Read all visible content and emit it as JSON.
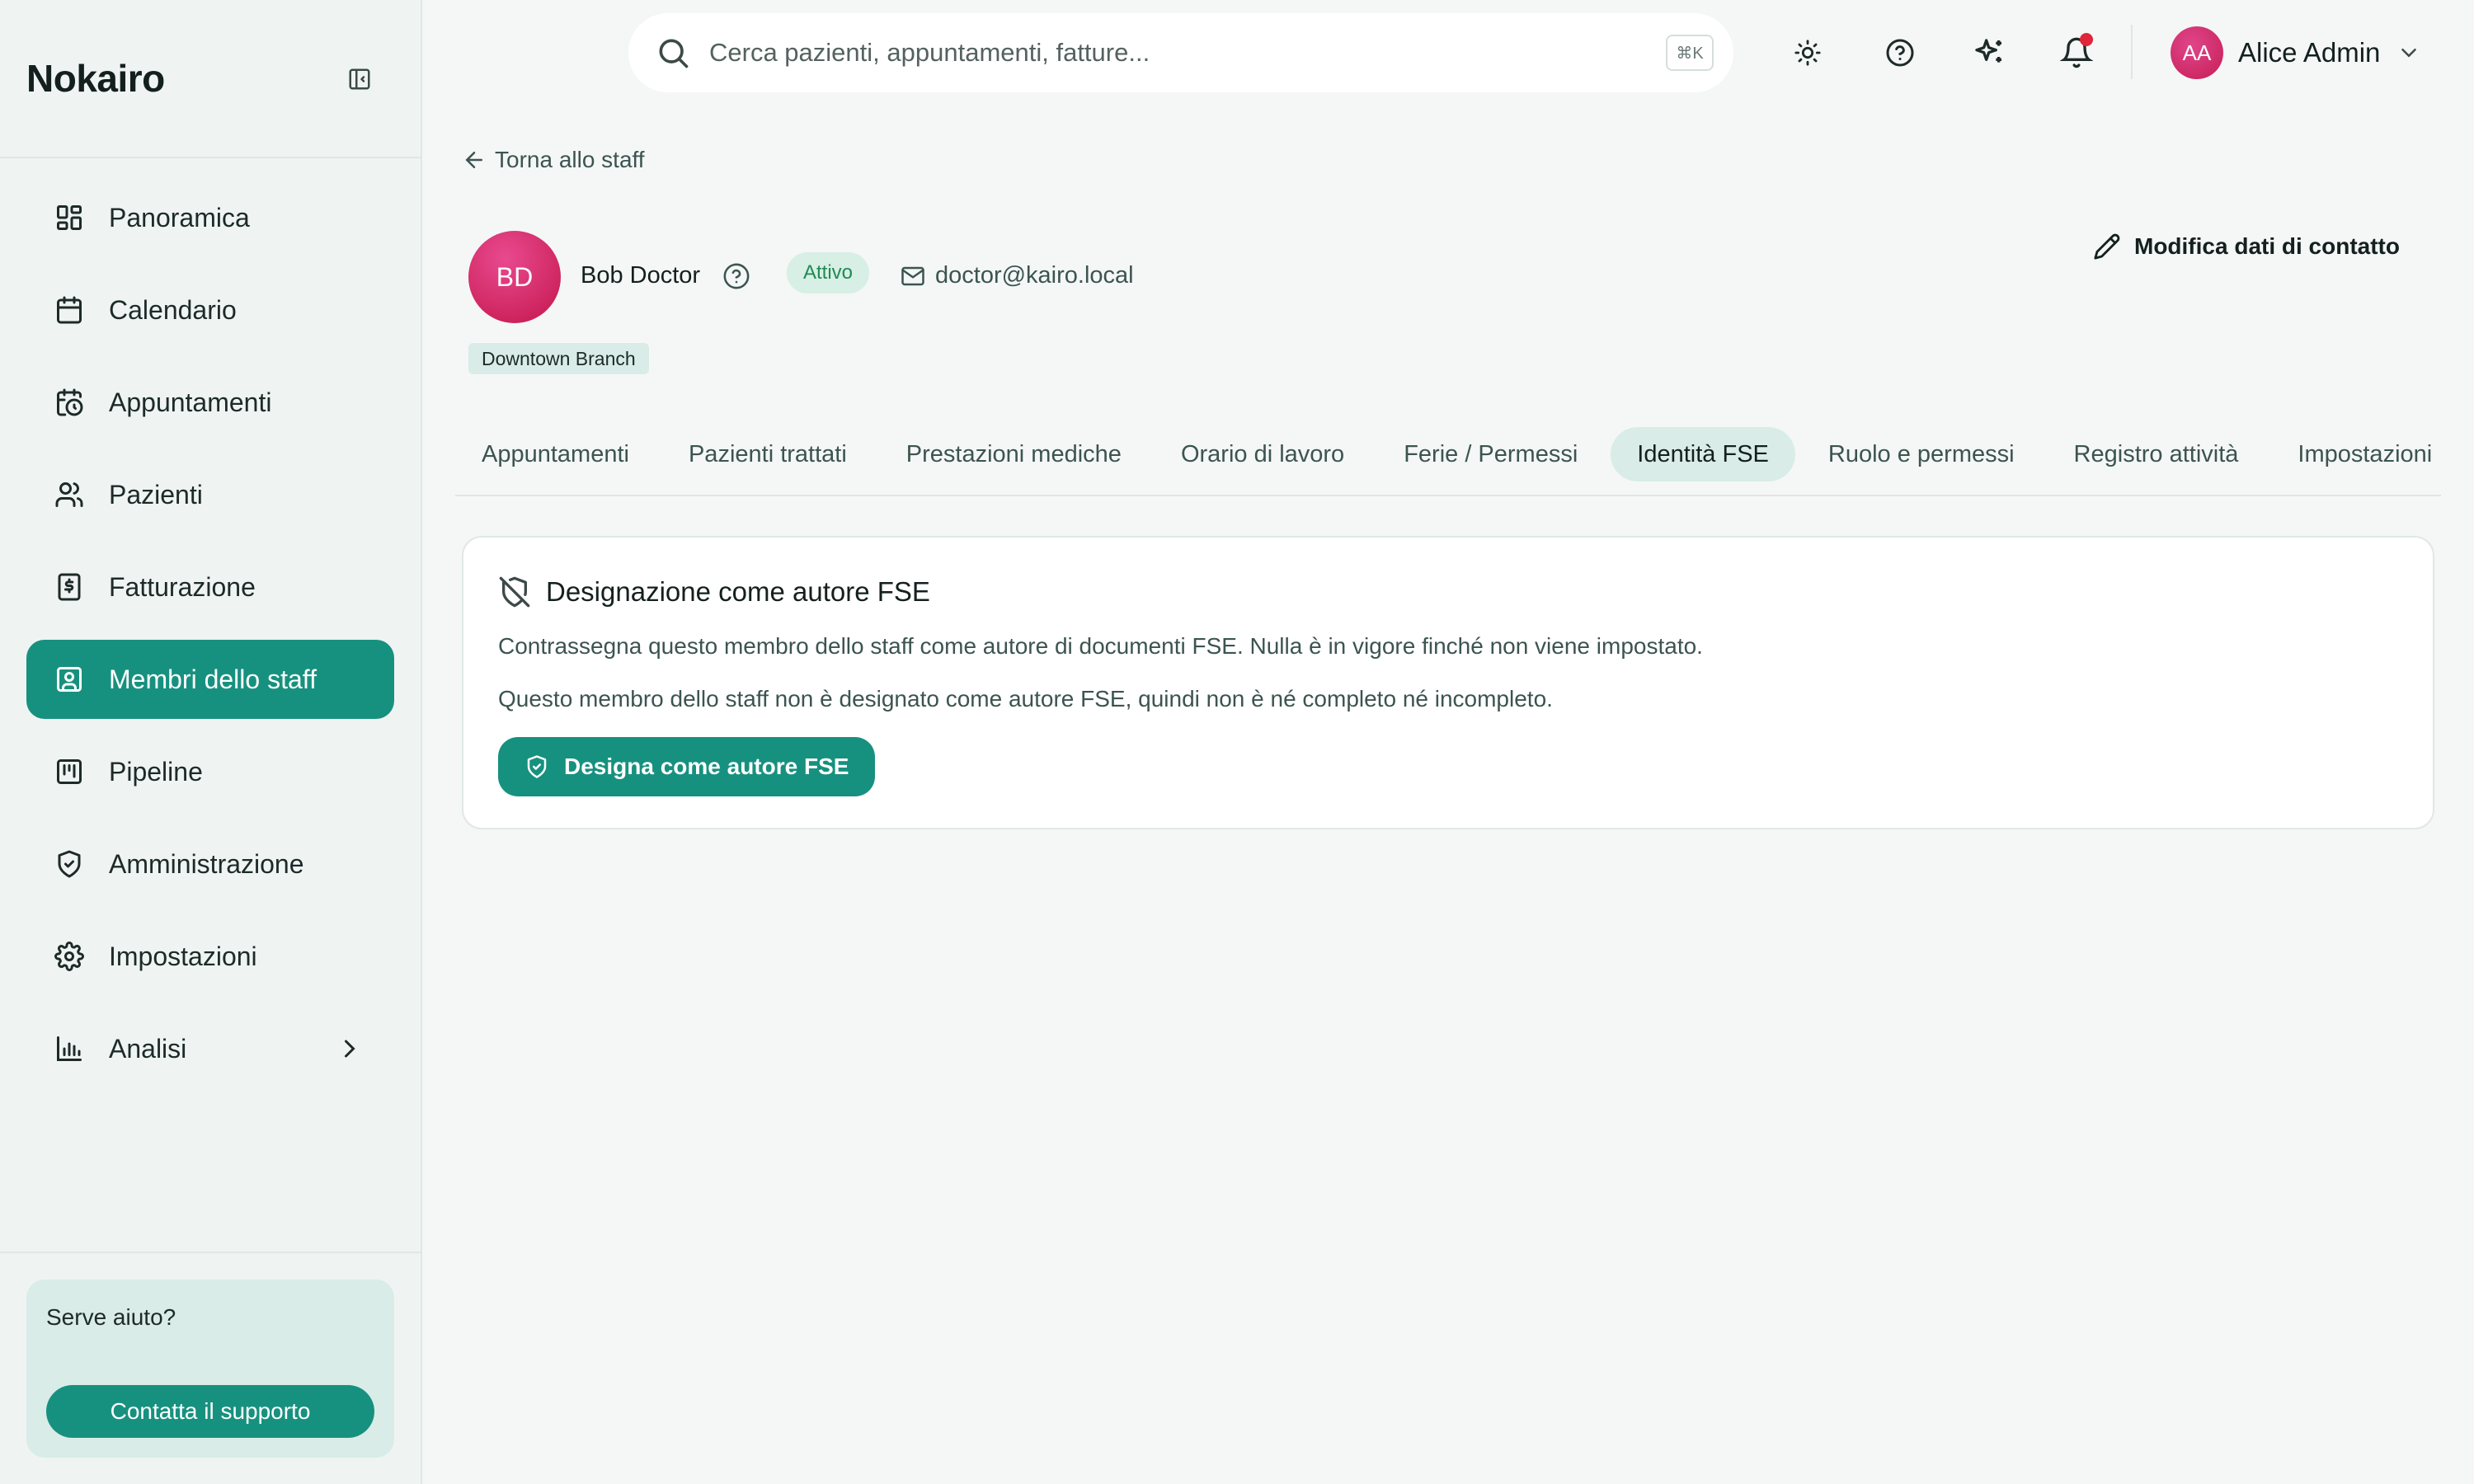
{
  "app": {
    "brand": "Nokairo"
  },
  "sidebar": {
    "items": [
      {
        "label": "Panoramica",
        "icon": "dashboard-icon"
      },
      {
        "label": "Calendario",
        "icon": "calendar-icon"
      },
      {
        "label": "Appuntamenti",
        "icon": "calendar-clock-icon"
      },
      {
        "label": "Pazienti",
        "icon": "users-icon"
      },
      {
        "label": "Fatturazione",
        "icon": "invoice-icon"
      },
      {
        "label": "Membri dello staff",
        "icon": "staff-badge-icon",
        "active": true
      },
      {
        "label": "Pipeline",
        "icon": "kanban-icon"
      },
      {
        "label": "Amministrazione",
        "icon": "shield-check-icon"
      },
      {
        "label": "Impostazioni",
        "icon": "gear-icon"
      },
      {
        "label": "Analisi",
        "icon": "bar-chart-icon",
        "expandable": true
      }
    ],
    "help": {
      "title": "Serve aiuto?",
      "button": "Contatta il supporto"
    }
  },
  "topbar": {
    "search_placeholder": "Cerca pazienti, appuntamenti, fatture...",
    "shortcut": "⌘K",
    "user": {
      "initials": "AA",
      "name": "Alice Admin"
    }
  },
  "profile": {
    "back_label": "Torna allo staff",
    "initials": "BD",
    "name": "Bob Doctor",
    "status": "Attivo",
    "email": "doctor@kairo.local",
    "branch": "Downtown Branch",
    "edit_label": "Modifica dati di contatto"
  },
  "tabs": [
    {
      "label": "Appuntamenti"
    },
    {
      "label": "Pazienti trattati"
    },
    {
      "label": "Prestazioni mediche"
    },
    {
      "label": "Orario di lavoro"
    },
    {
      "label": "Ferie / Permessi"
    },
    {
      "label": "Identità FSE",
      "active": true
    },
    {
      "label": "Ruolo e permessi"
    },
    {
      "label": "Registro attività"
    },
    {
      "label": "Impostazioni"
    }
  ],
  "card": {
    "title": "Designazione come autore FSE",
    "description": "Contrassegna questo membro dello staff come autore di documenti FSE. Nulla è in vigore finché non viene impostato.",
    "note": "Questo membro dello staff non è designato come autore FSE, quindi non è né completo né incompleto.",
    "button": "Designa come autore FSE"
  },
  "colors": {
    "accent": "#17917f",
    "accent_soft": "#d9ece8",
    "notification": "#e0243a",
    "avatar": "#d12a6a",
    "status_text": "#1f8a55"
  }
}
